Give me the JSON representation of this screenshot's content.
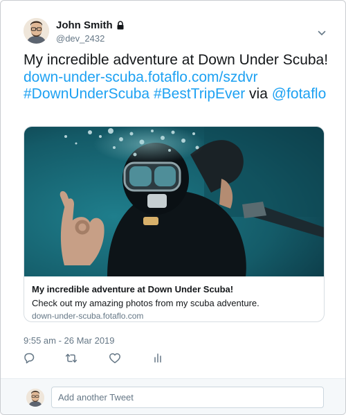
{
  "colors": {
    "link": "#1da1f2",
    "text": "#14171a",
    "muted": "#657786",
    "border": "#d7dde2"
  },
  "user": {
    "display_name": "John Smith",
    "handle": "@dev_2432",
    "protected_icon": "lock-icon",
    "menu_icon": "chevron-down-icon"
  },
  "tweet": {
    "text_before": "My incredible adventure at Down Under Scuba! ",
    "link_url": "down-under-scuba.fotaflo.com/szdvr",
    "hashtag1": "#DownUnderScuba",
    "hashtag2": "#BestTripEver",
    "via_text": " via ",
    "mention": "@fotaflo",
    "timestamp": "9:55 am - 26 Mar 2019"
  },
  "card": {
    "image_subject": "scuba diver underwater making OK hand sign",
    "title": "My incredible adventure at Down Under Scuba!",
    "description": "Check out my amazing photos from my scuba adventure.",
    "domain": "down-under-scuba.fotaflo.com"
  },
  "actions": [
    {
      "name": "reply",
      "icon": "reply-icon"
    },
    {
      "name": "retweet",
      "icon": "retweet-icon"
    },
    {
      "name": "like",
      "icon": "heart-icon"
    },
    {
      "name": "analytics",
      "icon": "analytics-icon"
    }
  ],
  "reply_box": {
    "placeholder": "Add another Tweet"
  }
}
